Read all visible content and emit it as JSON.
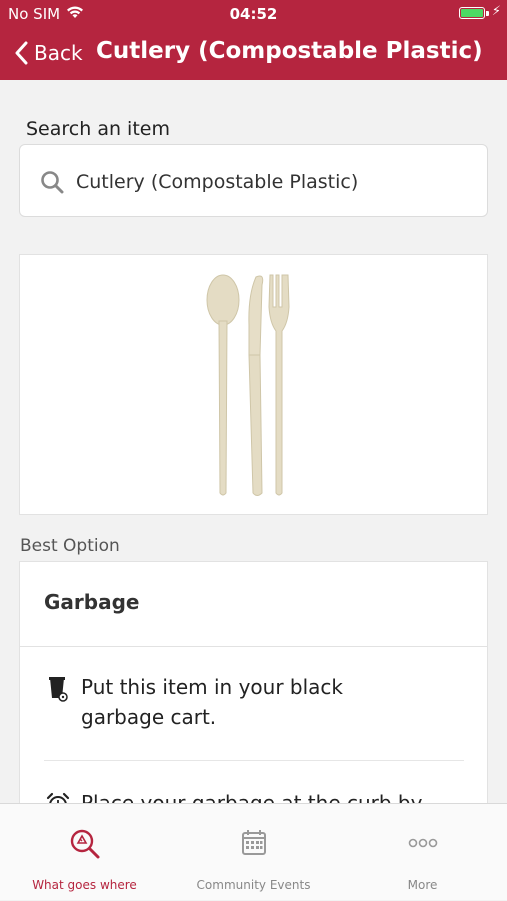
{
  "status_bar": {
    "carrier": "No SIM",
    "time": "04:52",
    "battery_color": "#4cd964"
  },
  "nav": {
    "back_label": "Back",
    "title": "Cutlery (Compostable Plastic)",
    "bar_color": "#b5253f"
  },
  "search": {
    "label": "Search an item",
    "value": "Cutlery (Compostable Plastic)",
    "icon": "search-icon"
  },
  "item_image": {
    "icon": "cutlery-image"
  },
  "best_option": {
    "section_label": "Best Option",
    "heading": "Garbage",
    "instructions": [
      {
        "icon": "garbage-cart-icon",
        "text": "Put this item in your black garbage cart."
      },
      {
        "icon": "alarm-clock-icon",
        "text": "Place your garbage at the curb by"
      }
    ]
  },
  "tabs": [
    {
      "label": "What goes where",
      "icon": "recycle-search-icon",
      "active": true
    },
    {
      "label": "Community Events",
      "icon": "calendar-icon",
      "active": false
    },
    {
      "label": "More",
      "icon": "more-dots-icon",
      "active": false
    }
  ],
  "colors": {
    "accent": "#b5253f",
    "tab_inactive": "#888888"
  }
}
